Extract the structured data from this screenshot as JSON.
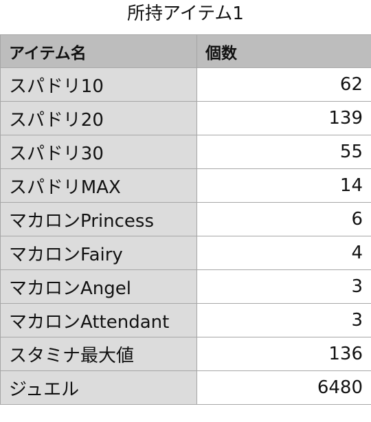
{
  "title": "所持アイテム1",
  "table": {
    "headers": [
      "アイテム名",
      "個数"
    ],
    "rows": [
      {
        "name": "スパドリ10",
        "count": "62"
      },
      {
        "name": "スパドリ20",
        "count": "139"
      },
      {
        "name": "スパドリ30",
        "count": "55"
      },
      {
        "name": "スパドリMAX",
        "count": "14"
      },
      {
        "name": "マカロンPrincess",
        "count": "6"
      },
      {
        "name": "マカロンFairy",
        "count": "4"
      },
      {
        "name": "マカロンAngel",
        "count": "3"
      },
      {
        "name": "マカロンAttendant",
        "count": "3"
      },
      {
        "name": "スタミナ最大値",
        "count": "136"
      },
      {
        "name": "ジュエル",
        "count": "6480"
      }
    ]
  },
  "colors": {
    "header_bg": "#bdbdbd",
    "name_cell_bg": "#dcdcdc",
    "count_cell_bg": "#ffffff",
    "grid_line": "#a6a6a6"
  }
}
